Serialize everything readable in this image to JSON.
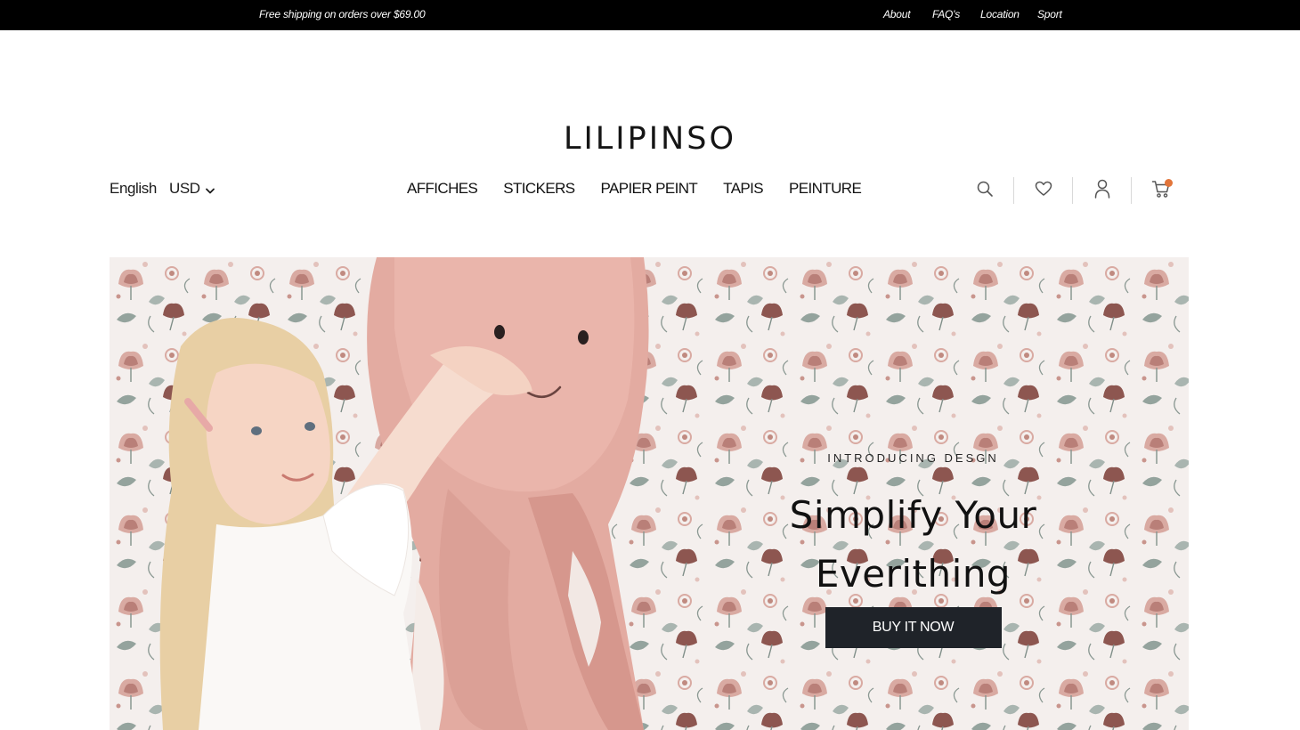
{
  "announcement": {
    "promo": "Free shipping on orders over $69.00",
    "links": [
      "About",
      "FAQ's",
      "Location",
      "Sport"
    ]
  },
  "brand": {
    "logo": "LILIPINSO"
  },
  "locale": {
    "language": "English",
    "currency": "USD"
  },
  "nav": [
    "AFFICHES",
    "STICKERS",
    "PAPIER PEINT",
    "TAPIS",
    "PEINTURE"
  ],
  "tools": {
    "icons": [
      "search-icon",
      "heart-icon",
      "user-icon",
      "cart-icon"
    ],
    "cart_badge_color": "#e2753a"
  },
  "hero": {
    "eyebrow": "INTRODUCING DESGN",
    "title_line1": "Simplify Your",
    "title_line2": "Everithing",
    "cta": "BUY IT NOW"
  },
  "colors": {
    "topbar": "#000000",
    "button": "#1f2329",
    "accent": "#e2753a",
    "wallpaper": "#f3eeec"
  }
}
